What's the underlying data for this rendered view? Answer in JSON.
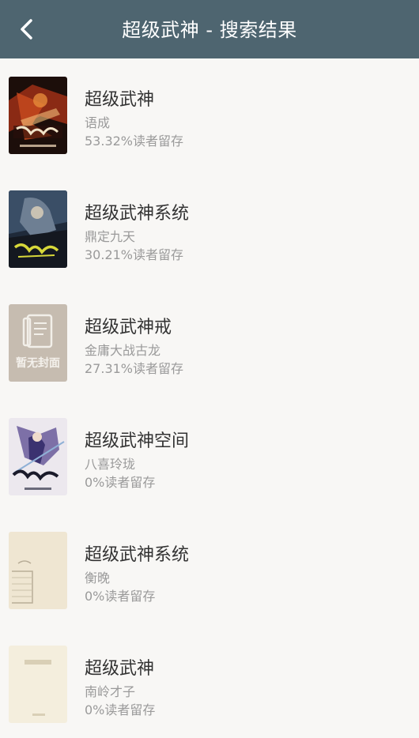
{
  "header": {
    "title": "超级武神 - 搜索结果",
    "back_icon": "chevron-left-icon",
    "background_color": "#4e6570"
  },
  "results": [
    {
      "title": "超级武神",
      "author": "语成",
      "retention": "53.32%读者留存",
      "cover": "red-warrior-cover"
    },
    {
      "title": "超级武神系统",
      "author": "鼎定九天",
      "retention": "30.21%读者留存",
      "cover": "dark-blue-warrior-cover"
    },
    {
      "title": "超级武神戒",
      "author": "金庸大战古龙",
      "retention": "27.31%读者留存",
      "cover": "default-cover",
      "cover_text": "暂无封面"
    },
    {
      "title": "超级武神空间",
      "author": "八喜玲珑",
      "retention": "0%读者留存",
      "cover": "purple-swordsman-cover"
    },
    {
      "title": "超级武神系统",
      "author": "衡晚",
      "retention": "0%读者留存",
      "cover": "beige-sketch-cover"
    },
    {
      "title": "超级武神",
      "author": "南岭才子",
      "retention": "0%读者留存",
      "cover": "cream-plain-cover"
    }
  ]
}
